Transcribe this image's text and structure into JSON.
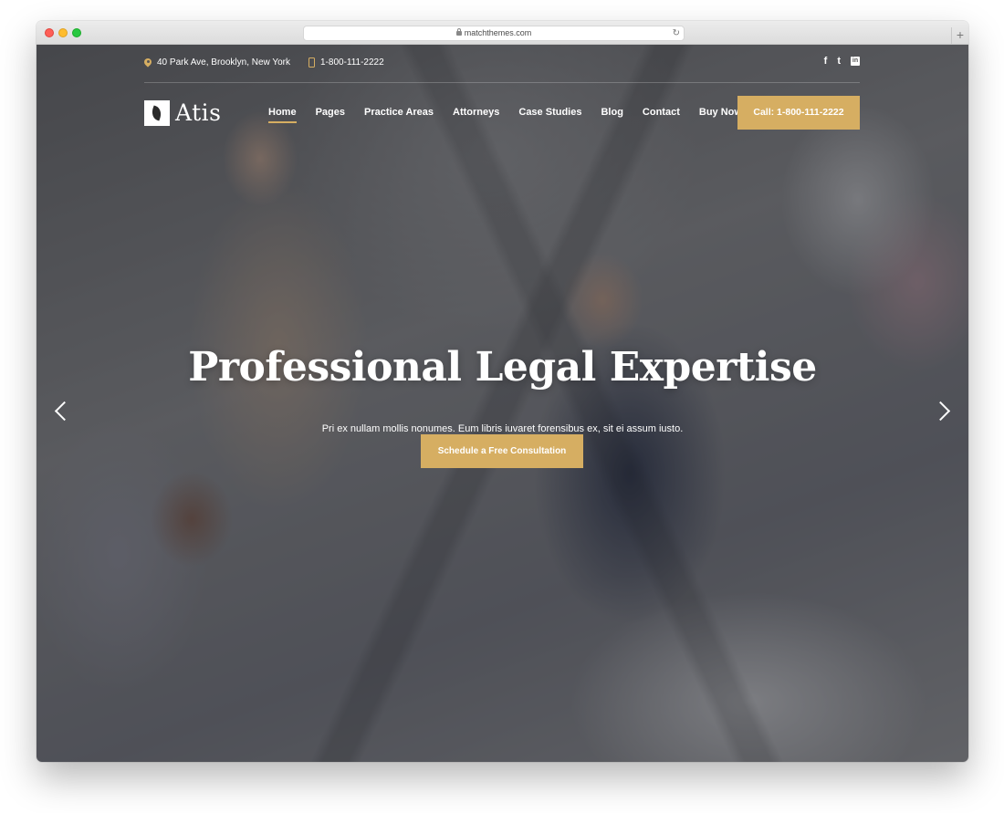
{
  "browser": {
    "url": "matchthemes.com",
    "reload_icon": "reload-icon",
    "newtab_label": "+"
  },
  "topbar": {
    "address": "40 Park Ave, Brooklyn, New York",
    "phone": "1-800-111-2222",
    "social": {
      "facebook": "f",
      "twitter": "t",
      "linkedin": "in"
    }
  },
  "nav": {
    "logo_text": "Atis",
    "items": [
      {
        "label": "Home",
        "active": true
      },
      {
        "label": "Pages"
      },
      {
        "label": "Practice Areas"
      },
      {
        "label": "Attorneys"
      },
      {
        "label": "Case Studies"
      },
      {
        "label": "Blog"
      },
      {
        "label": "Contact"
      },
      {
        "label": "Buy Now"
      }
    ],
    "call_button": "Call: 1-800-111-2222"
  },
  "hero": {
    "title": "Professional Legal Expertise",
    "subtitle": "Pri ex nullam mollis nonumes. Eum libris iuvaret forensibus ex, sit ei assum iusto.",
    "cta": "Schedule a Free Consultation"
  },
  "colors": {
    "accent": "#d6ae62",
    "text": "#ffffff"
  }
}
